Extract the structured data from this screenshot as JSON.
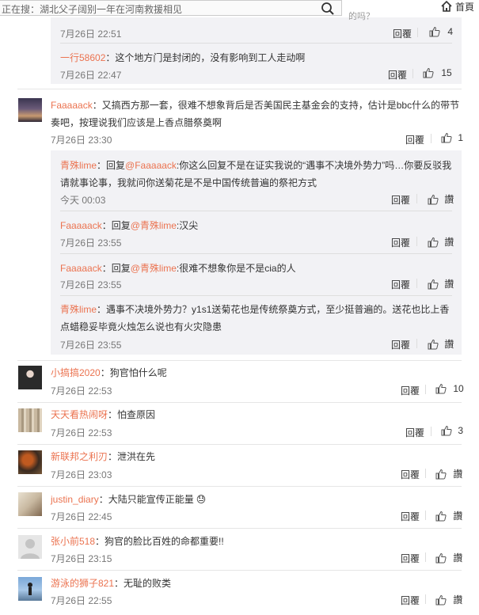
{
  "topbar": {
    "search_text": "正在搜：湖北父子阔别一年在河南救援相见",
    "bleed_text": "的吗？",
    "home_label": "首頁"
  },
  "top_sub": [
    {
      "time": "7月26日 22:51",
      "reply": "回覆",
      "likes": "4"
    },
    {
      "user": "一行58602",
      "sep": "：",
      "text": "这个地方门是封闭的，没有影响到工人走动啊",
      "time": "7月26日 22:47",
      "reply": "回覆",
      "likes": "15"
    }
  ],
  "comments": [
    {
      "user": "Faaaaack",
      "sep": "：",
      "text1": "又搞西方那一套，很难不想象背后是否美国民主基金会的支持，估计是bbc什么的带节",
      "text2": "奏吧，按理说我们应该是上香点腊祭奠啊",
      "time": "7月26日 23:30",
      "reply": "回覆",
      "likes": "1",
      "replies": [
        {
          "user": "青殊lime",
          "t1": "：回复",
          "mention": "@Faaaaack",
          "text1": ":你这么回复不是在证实我说的“遇事不决境外势力”吗…你要反驳我",
          "text2": "请就事论事，我就问你送菊花是不是中国传统普遍的祭祀方式",
          "time": "今天 00:03",
          "reply": "回覆",
          "likes": "讚"
        },
        {
          "user": "Faaaaack",
          "t1": "：回复",
          "mention": "@青殊lime",
          "text1": ":汉尖",
          "time": "7月26日 23:55",
          "reply": "回覆",
          "likes": "讚"
        },
        {
          "user": "Faaaaack",
          "t1": "：回复",
          "mention": "@青殊lime",
          "text1": ":很难不想象你是不是cia的人",
          "time": "7月26日 23:55",
          "reply": "回覆",
          "likes": "讚"
        },
        {
          "user": "青殊lime",
          "t1": "：",
          "text1": "遇事不决境外势力？y1s1送菊花也是传统祭奠方式，至少挺普遍的。送花也比上香",
          "text2": "点蜡稳妥毕竟火烛怎么说也有火灾隐患",
          "time": "7月26日 23:55",
          "reply": "回覆",
          "likes": "讚"
        }
      ]
    },
    {
      "user": "小搞搞2020",
      "sep": "：",
      "text1": "狗官怕什么呢",
      "time": "7月26日 22:53",
      "reply": "回覆",
      "likes": "10"
    },
    {
      "user": "天天看热闹呀",
      "sep": "：",
      "text1": "怕查原因",
      "time": "7月26日 22:53",
      "reply": "回覆",
      "likes": "3"
    },
    {
      "user": "新联邦之利刃",
      "sep": "：",
      "text1": "泄洪在先",
      "time": "7月26日 23:03",
      "reply": "回覆",
      "likes": "讚"
    },
    {
      "user": "justin_diary",
      "sep": "：",
      "text1": "大陆只能宣传正能量",
      "emoji": "😓",
      "time": "7月26日 22:45",
      "reply": "回覆",
      "likes": "讚"
    },
    {
      "user": "张小前518",
      "sep": "：",
      "text1": "狗官的脸比百姓的命都重要!!",
      "time": "7月26日 23:15",
      "reply": "回覆",
      "likes": "讚"
    },
    {
      "user": "游泳的狮子821",
      "sep": "：",
      "text1": "无耻的败类",
      "time": "7月26日 22:55",
      "reply": "回覆",
      "likes": "讚"
    }
  ],
  "colors": {
    "username": "#eb7350",
    "sub_bg": "#f2f2f5",
    "time": "#777777"
  }
}
